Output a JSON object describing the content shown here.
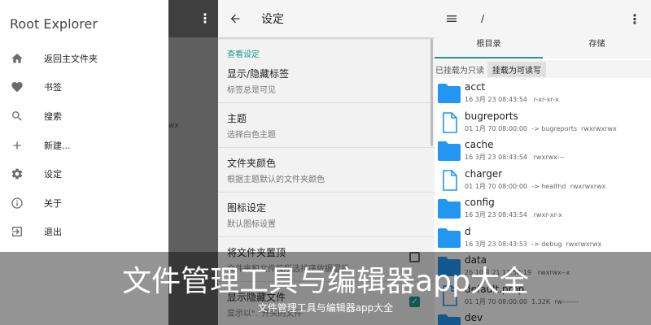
{
  "drawer": {
    "title": "Root Explorer",
    "items": [
      {
        "icon": "home-icon",
        "label": "返回主文件夹"
      },
      {
        "icon": "heart-icon",
        "label": "书签"
      },
      {
        "icon": "search-icon",
        "label": "搜索"
      },
      {
        "icon": "plus-icon",
        "label": "新建..."
      },
      {
        "icon": "gear-icon",
        "label": "设定"
      },
      {
        "icon": "info-icon",
        "label": "关于"
      },
      {
        "icon": "exit-icon",
        "label": "退出"
      }
    ],
    "underlay_text": "wx"
  },
  "settings": {
    "title": "设定",
    "section": "查看设定",
    "items": [
      {
        "title": "显示/隐藏标签",
        "subtitle": "标签总是可见"
      },
      {
        "title": "主题",
        "subtitle": "选择白色主题"
      },
      {
        "title": "文件夹颜色",
        "subtitle": "根据主题默认的文件夹颜色"
      },
      {
        "title": "图标设定",
        "subtitle": "默认图标设置"
      },
      {
        "title": "将文件夹置顶",
        "subtitle": "文件夹和文件按所选排序依据混排",
        "checked": false
      },
      {
        "title": "显示隐藏文件",
        "subtitle": "显示以\".\"开头的文件",
        "checked": true
      }
    ]
  },
  "explorer": {
    "path": "/",
    "tabs": [
      "根目录",
      "存储"
    ],
    "active_tab": 0,
    "mount_label": "已挂载为只读",
    "mount_button": "挂载为可读写",
    "files": [
      {
        "name": "acct",
        "type": "folder",
        "meta": "16 3月 23 08:43:54   r-xr-xr-x"
      },
      {
        "name": "bugreports",
        "type": "file",
        "meta": "01 1月 70 08:00:00  -> bugreports  rwxrwxrwx"
      },
      {
        "name": "cache",
        "type": "folder",
        "meta": "16 3月 23 08:43:54   rwxrwx---"
      },
      {
        "name": "charger",
        "type": "file",
        "meta": "01 1月 70 08:00:00  -> healthd  rwxrwxrwx"
      },
      {
        "name": "config",
        "type": "folder",
        "meta": "16 3月 23 08:43:54   rwxr-xr-x"
      },
      {
        "name": "d",
        "type": "folder",
        "meta": "16 3月 23 08:43:53  -> debug  rwxrwxrwx"
      },
      {
        "name": "data",
        "type": "folder",
        "meta": "26 10月 21 11:58:19   rwxrwx--x"
      },
      {
        "name": "default.prop",
        "type": "file",
        "meta": "01 1月 70 08:00:00  1.32K  rw-------"
      },
      {
        "name": "dev",
        "type": "folder",
        "meta": ""
      }
    ]
  },
  "banner": {
    "title": "文件管理工具与编辑器app大全",
    "subtitle": "文件管理工具与编辑器app大全"
  },
  "colors": {
    "accent": "#1b9a86",
    "folder": "#2196f3"
  }
}
